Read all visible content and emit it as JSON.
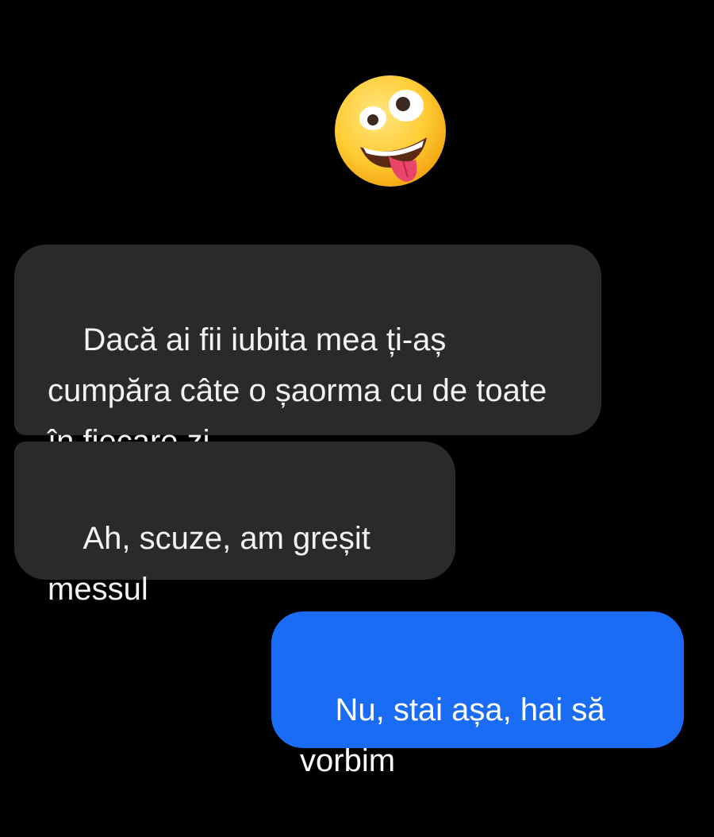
{
  "conversation": {
    "header_emoji": "zany-face-icon",
    "colors": {
      "background": "#000000",
      "incoming_bubble": "#2a2a2a",
      "outgoing_bubble": "#1a6cf5",
      "text": "#f2f2f2"
    },
    "messages": [
      {
        "direction": "incoming",
        "text": "Dacă ai fii iubita mea ți-aș cumpăra câte o șaorma cu de toate în fiecare zi"
      },
      {
        "direction": "incoming",
        "text": "Ah, scuze, am greșit messul"
      },
      {
        "direction": "outgoing",
        "text": "Nu, stai așa, hai să vorbim"
      }
    ]
  }
}
